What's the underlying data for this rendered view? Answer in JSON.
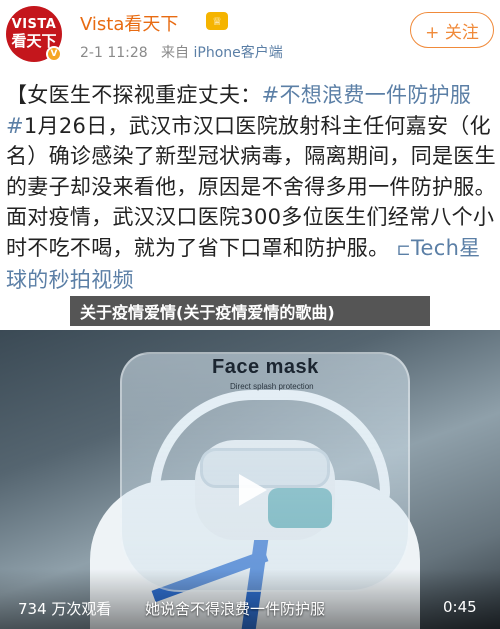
{
  "account": {
    "avatar_line1": "VISTA",
    "avatar_line2": "看天下",
    "name": "Vista看天下",
    "post_time": "2-1 11:28",
    "source_prefix": "来自",
    "source": "iPhone客户端",
    "follow_label": "+ 关注"
  },
  "post": {
    "title_open": "【女医生不探视重症丈夫：",
    "hashtag": "#不想浪费一件防护服#",
    "text": "1月26日，武汉市汉口医院放射科主任何嘉安（化名）确诊感染了新型冠状病毒，隔离期间，同是医生的妻子却没来看他，原因是不舍得多用一件防护服。面对疫情，武汉汉口医院300多位医生们经常八个小时不吃不喝，就为了省下口罩和防护服。",
    "link_text": "Tech星球的秒拍视频"
  },
  "overlay_title": "关于疫情爱情(关于疫情爱情的歌曲)",
  "video": {
    "mask_label": "Face mask",
    "mask_sub": "Direct splash protection",
    "views": "734 万次观看",
    "subtitle": "她说舍不得浪费一件防护服",
    "duration": "0:45"
  },
  "colors": {
    "name": "#e86b12",
    "link": "#5b7fa6",
    "follow": "#f08a3a",
    "avatar_bg": "#c4161c"
  },
  "icons": [
    "verified-badge-icon",
    "level-icon",
    "video-link-icon",
    "play-icon"
  ]
}
